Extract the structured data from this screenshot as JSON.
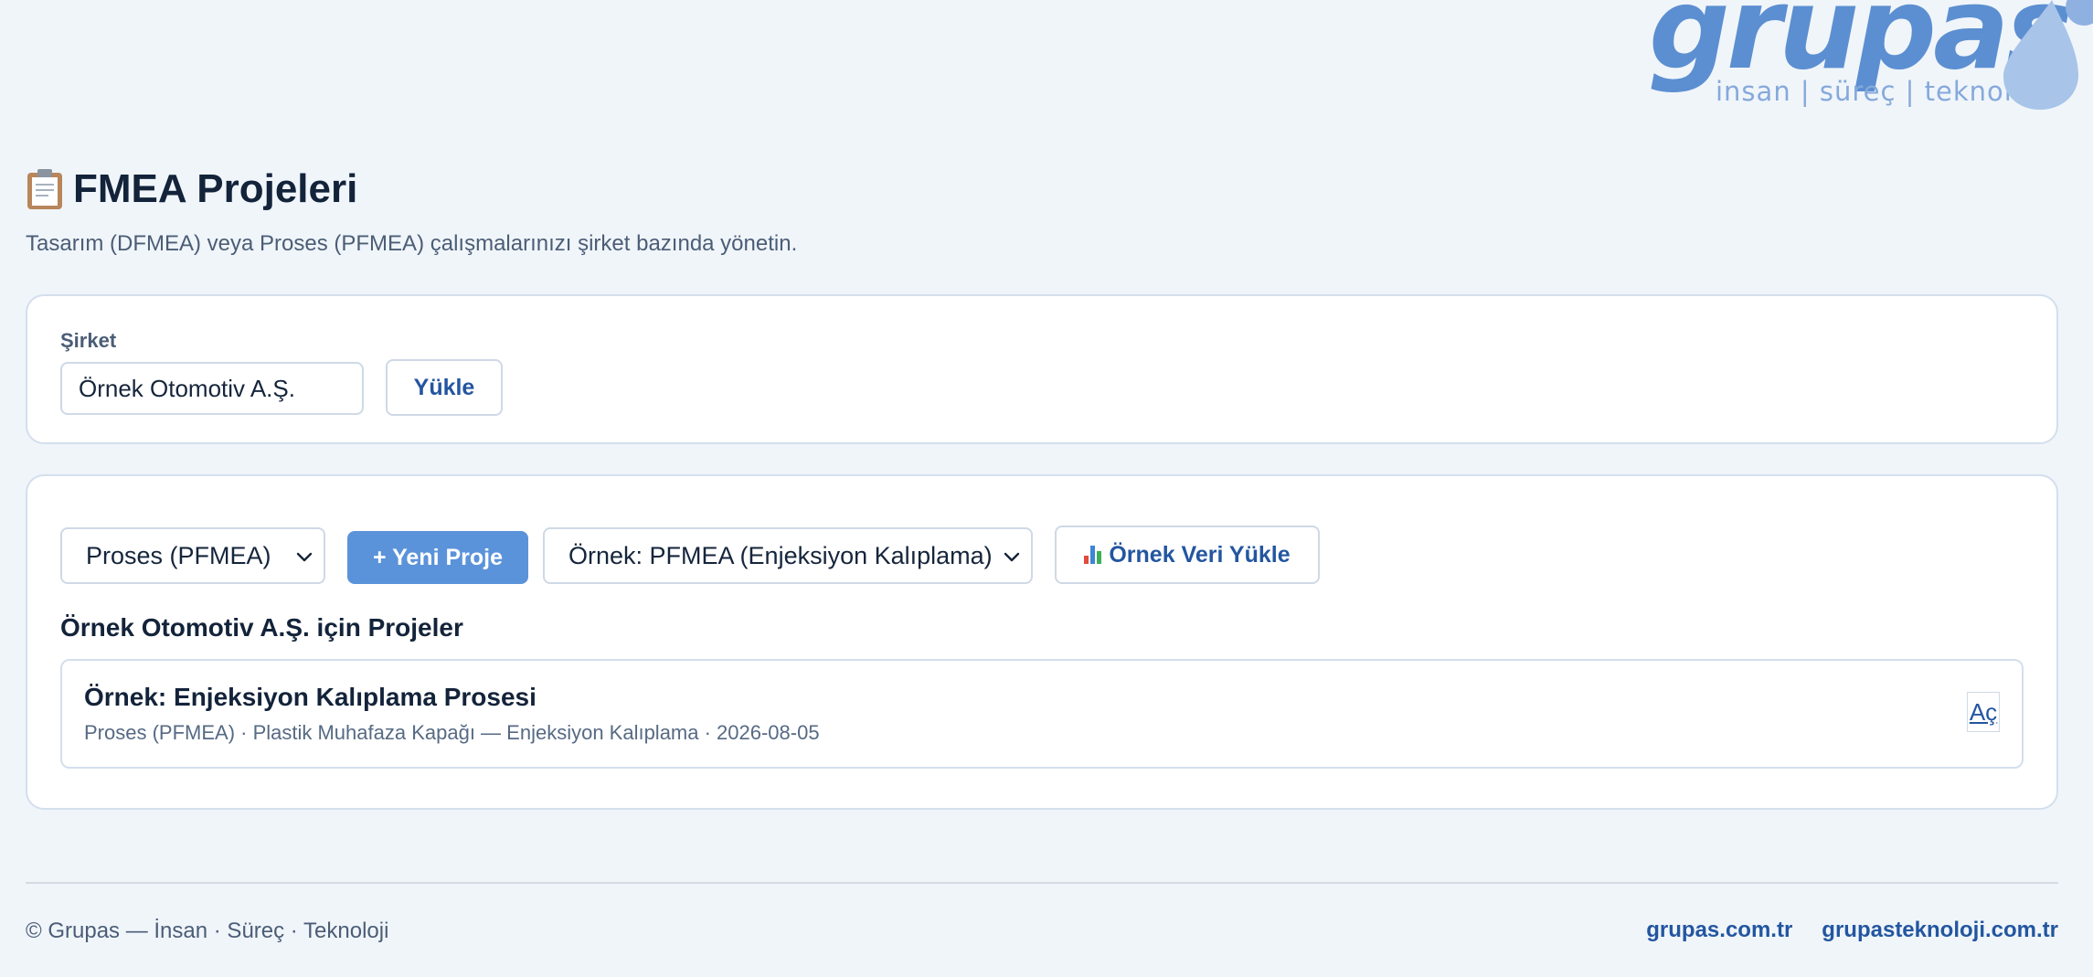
{
  "brand": {
    "logo_word": "grupas",
    "logo_tagline": "insan | süreç | teknoloji",
    "logo_color": "#5c8fd1"
  },
  "header": {
    "title_icon": "clipboard-icon",
    "title": "FMEA Projeleri",
    "subtitle": "Tasarım (DFMEA) veya Proses (PFMEA) çalışmalarınızı şirket bazında yönetin."
  },
  "company": {
    "label": "Şirket",
    "value": "Örnek Otomotiv A.Ş.",
    "load_button": "Yükle"
  },
  "projects": {
    "type_select": "Proses (PFMEA)",
    "new_project_button": "+ Yeni Proje",
    "sample_select": "Örnek: PFMEA (Enjeksiyon Kalıplama)",
    "sample_load_icon": "bar-chart-icon",
    "sample_load_button": "Örnek Veri Yükle",
    "heading": "Örnek Otomotiv A.Ş. için Projeler",
    "items": [
      {
        "title": "Örnek: Enjeksiyon Kalıplama Prosesi",
        "meta": "Proses (PFMEA) · Plastik Muhafaza Kapağı — Enjeksiyon Kalıplama · 2026-08-05",
        "open_label": "Aç"
      }
    ]
  },
  "footer": {
    "copyright": "© Grupas — İnsan · Süreç · Teknoloji",
    "links": [
      "grupas.com.tr",
      "grupasteknoloji.com.tr"
    ]
  },
  "colors": {
    "accent": "#5b93da",
    "link": "#2356a0",
    "background": "#f0f5fa"
  }
}
